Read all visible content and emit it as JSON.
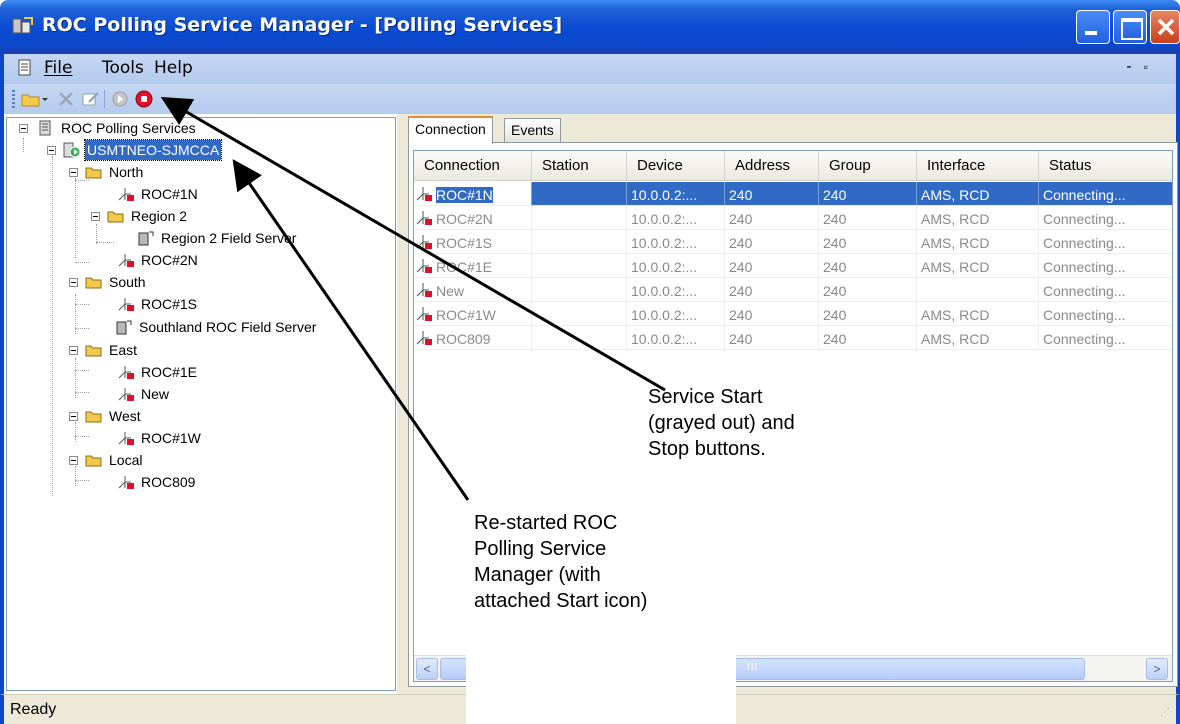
{
  "window": {
    "title": "ROC Polling Service Manager - [Polling Services]",
    "minimize_glyph": "_",
    "restore_glyph": "🗗"
  },
  "menu": {
    "file": "File",
    "tools": "Tools",
    "help": "Help",
    "mdi_minimize": "-",
    "mdi_restore": "🗗"
  },
  "toolbar": {
    "icons": [
      "open-folder-icon",
      "dropdown-arrow-icon",
      "delete-icon",
      "edit-icon",
      "service-start-icon",
      "service-stop-icon"
    ]
  },
  "tree": {
    "root": "ROC Polling Services",
    "server": "USMTNEO-SJMCCA",
    "north": "North",
    "north_roc1n": "ROC#1N",
    "region2": "Region 2",
    "region2_field_server": "Region 2 Field Server",
    "north_roc2n": "ROC#2N",
    "south": "South",
    "south_roc1s": "ROC#1S",
    "southland_field_server": "Southland ROC Field Server",
    "east": "East",
    "east_roc1e": "ROC#1E",
    "east_new": "New",
    "west": "West",
    "west_roc1w": "ROC#1W",
    "local": "Local",
    "local_roc809": "ROC809"
  },
  "tabs": {
    "connection": "Connection",
    "events": "Events"
  },
  "table": {
    "columns": [
      "Connection",
      "Station",
      "Device",
      "Address",
      "Group",
      "Interface",
      "Status"
    ],
    "rows": [
      [
        "ROC#1N",
        "",
        "10.0.0.2:...",
        "240",
        "240",
        "AMS, RCD",
        "Connecting..."
      ],
      [
        "ROC#2N",
        "",
        "10.0.0.2:...",
        "240",
        "240",
        "AMS, RCD",
        "Connecting..."
      ],
      [
        "ROC#1S",
        "",
        "10.0.0.2:...",
        "240",
        "240",
        "AMS, RCD",
        "Connecting..."
      ],
      [
        "ROC#1E",
        "",
        "10.0.0.2:...",
        "240",
        "240",
        "AMS, RCD",
        "Connecting..."
      ],
      [
        "New",
        "",
        "10.0.0.2:...",
        "240",
        "240",
        "",
        "Connecting..."
      ],
      [
        "ROC#1W",
        "",
        "10.0.0.2:...",
        "240",
        "240",
        "AMS, RCD",
        "Connecting..."
      ],
      [
        "ROC809",
        "",
        "10.0.0.2:...",
        "240",
        "240",
        "AMS, RCD",
        "Connecting..."
      ]
    ]
  },
  "scrollbar": {
    "left_arrow": "<",
    "right_arrow": ">"
  },
  "status": {
    "text": "Ready"
  },
  "annotations": {
    "service_start": "Service Start\n(grayed out) and\nStop buttons.",
    "restarted": "Re-started ROC\nPolling Service\nManager (with\nattached Start icon)"
  },
  "colors": {
    "titlebar": "#0c47c9",
    "selection": "#316ac5",
    "stop_button": "#e0102a",
    "folder": "#f2c94c"
  }
}
